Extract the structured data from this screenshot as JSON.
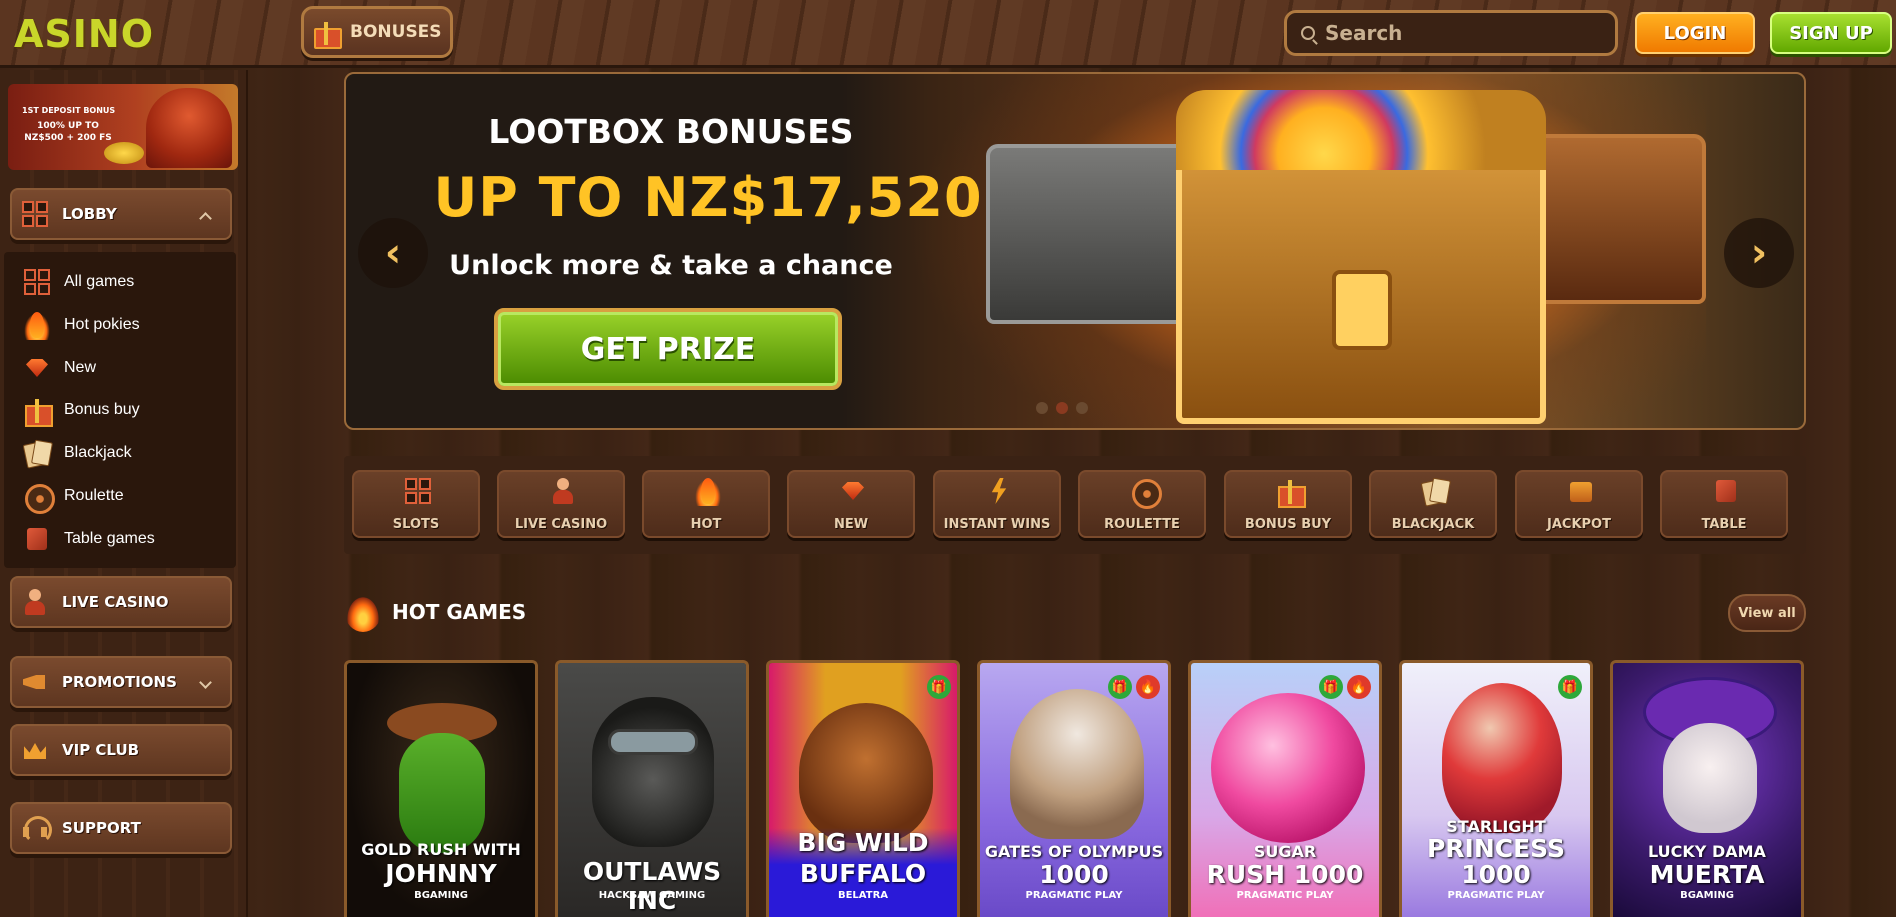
{
  "header": {
    "logo": "ASINO",
    "bonuses_label": "BONUSES",
    "search_placeholder": "Search",
    "login_label": "LOGIN",
    "signup_label": "SIGN UP"
  },
  "sidebar": {
    "promo": {
      "line1": "1ST DEPOSIT BONUS",
      "line2": "100% UP TO NZ$500 + 200 FS"
    },
    "lobby_label": "LOBBY",
    "lobby_items": [
      {
        "label": "All games",
        "icon": "grid-icon"
      },
      {
        "label": "Hot pokies",
        "icon": "fire-icon"
      },
      {
        "label": "New",
        "icon": "gem-icon"
      },
      {
        "label": "Bonus buy",
        "icon": "gift-icon"
      },
      {
        "label": "Blackjack",
        "icon": "cards-icon"
      },
      {
        "label": "Roulette",
        "icon": "roulette-icon"
      },
      {
        "label": "Table games",
        "icon": "dice-icon"
      }
    ],
    "live_casino_label": "LIVE CASINO",
    "promotions_label": "PROMOTIONS",
    "vip_label": "VIP CLUB",
    "support_label": "SUPPORT"
  },
  "hero": {
    "title": "LOOTBOX BONUSES",
    "amount": "UP TO NZ$17,520",
    "subtitle": "Unlock more  & take a chance",
    "cta": "GET PRIZE",
    "prev_arrow": "‹",
    "next_arrow": "›"
  },
  "categories": [
    {
      "label": "SLOTS",
      "icon": "grid-icon"
    },
    {
      "label": "LIVE CASINO",
      "icon": "dealer-icon"
    },
    {
      "label": "HOT",
      "icon": "fire-icon"
    },
    {
      "label": "NEW",
      "icon": "gem-icon"
    },
    {
      "label": "INSTANT WINS",
      "icon": "lightning-icon"
    },
    {
      "label": "ROULETTE",
      "icon": "roulette-icon"
    },
    {
      "label": "BONUS BUY",
      "icon": "gift-icon"
    },
    {
      "label": "BLACKJACK",
      "icon": "cards-icon"
    },
    {
      "label": "JACKPOT",
      "icon": "jackpot-icon"
    },
    {
      "label": "TABLE",
      "icon": "dice-icon"
    }
  ],
  "hot_games": {
    "title": "HOT GAMES",
    "view_all": "View all",
    "games": [
      {
        "line1": "GOLD RUSH WITH",
        "line2": "JOHNNY",
        "provider": "BGAMING",
        "badges": []
      },
      {
        "line1": "",
        "line2": "OUTLAWS INC",
        "provider": "HACKSAW GAMING",
        "badges": []
      },
      {
        "line1": "BIG WILD",
        "line2": "BUFFALO",
        "provider": "BELATRA",
        "badges": [
          "gift"
        ]
      },
      {
        "line1": "GATES OF OLYMPUS",
        "line2": "1000",
        "provider": "PRAGMATIC PLAY",
        "badges": [
          "gift",
          "fire"
        ]
      },
      {
        "line1": "SUGAR",
        "line2": "RUSH 1000",
        "provider": "PRAGMATIC PLAY",
        "badges": [
          "gift",
          "fire"
        ]
      },
      {
        "line1": "STARLIGHT",
        "line2": "PRINCESS",
        "line3": "1000",
        "provider": "PRAGMATIC PLAY",
        "badges": [
          "gift"
        ]
      },
      {
        "line1": "LUCKY DAMA",
        "line2": "MUERTA",
        "provider": "BGAMING",
        "badges": []
      }
    ]
  },
  "colors": {
    "accent_gold": "#ffc325",
    "cta_green": "#7ab81a",
    "login_orange": "#f58a00",
    "wood": "#4a2a18"
  }
}
